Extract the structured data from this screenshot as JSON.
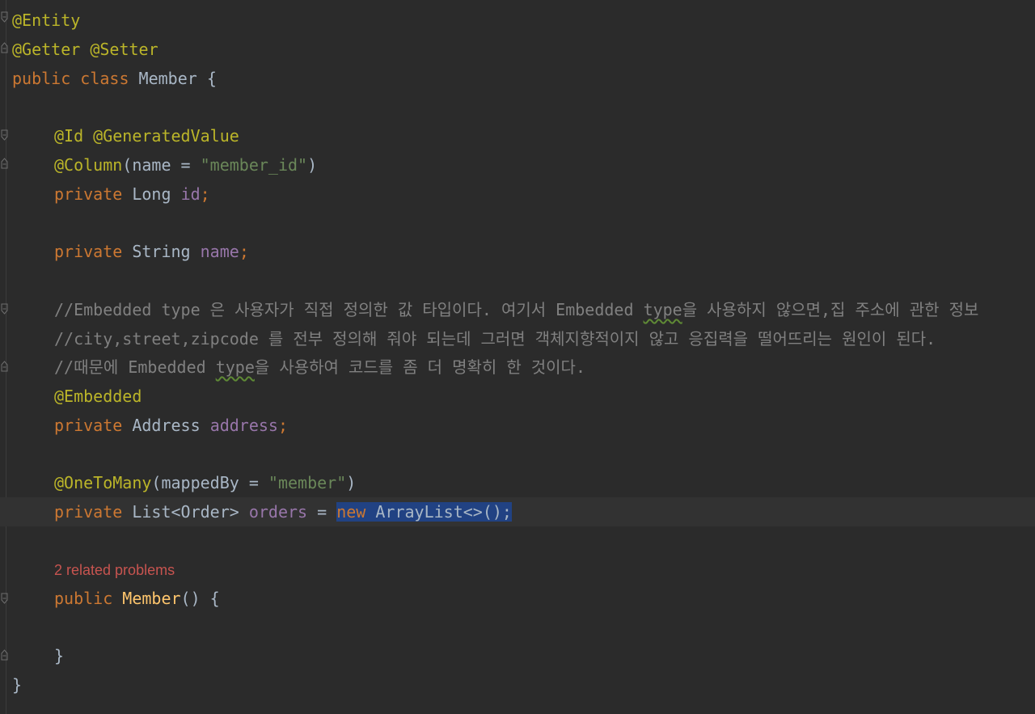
{
  "editor": {
    "lines": {
      "l1": {
        "annotation": "@Entity"
      },
      "l2": {
        "annotation1": "@Getter",
        "annotation2": "@Setter"
      },
      "l3": {
        "kw": "public class",
        "name": "Member",
        "brace": "{"
      },
      "l5": {
        "annotation1": "@Id",
        "annotation2": "@GeneratedValue"
      },
      "l6": {
        "annotation": "@Column",
        "open": "(name = ",
        "string": "\"member_id\"",
        "close": ")"
      },
      "l7": {
        "kw": "private",
        "type": "Long",
        "field": "id",
        "semi": ";"
      },
      "l9": {
        "kw": "private",
        "type": "String",
        "field": "name",
        "semi": ";"
      },
      "l11": {
        "c1": "//Embedded type 은 사용자가 직접 정의한 값 타입이다. 여기서 Embedded ",
        "c2": "type",
        "c3": "을 사용하지 않으면,집 주소에 관한 정보"
      },
      "l12": {
        "comment": "//city,street,zipcode 를 전부 정의해 줘야 되는데 그러면 객체지향적이지 않고 응집력을 떨어뜨리는 원인이 된다."
      },
      "l13": {
        "c1": "//때문에 Embedded ",
        "c2": "type",
        "c3": "을 사용하여 코드를 좀 더 명확히 한 것이다."
      },
      "l14": {
        "annotation": "@Embedded"
      },
      "l15": {
        "kw": "private",
        "type": "Address",
        "field": "address",
        "semi": ";"
      },
      "l17": {
        "annotation": "@OneToMany",
        "open": "(mappedBy = ",
        "string": "\"member\"",
        "close": ")"
      },
      "l18": {
        "kw": "private",
        "type": "List<Order>",
        "field": "orders",
        "eq": " = ",
        "new": "new",
        "rest": " ArrayList<>();"
      },
      "hint": "2 related problems",
      "l20": {
        "kw": "public",
        "method": "Member",
        "rest": "() {"
      },
      "l22": {
        "brace": "}"
      },
      "l23": {
        "brace": "}"
      }
    }
  },
  "colors": {
    "background": "#2b2b2b",
    "annotation": "#bbb529",
    "keyword": "#cc7832",
    "string": "#6a8759",
    "field": "#9876aa",
    "comment": "#808080",
    "method": "#ffc66d",
    "selection": "#214283",
    "error_hint": "#c75450"
  }
}
